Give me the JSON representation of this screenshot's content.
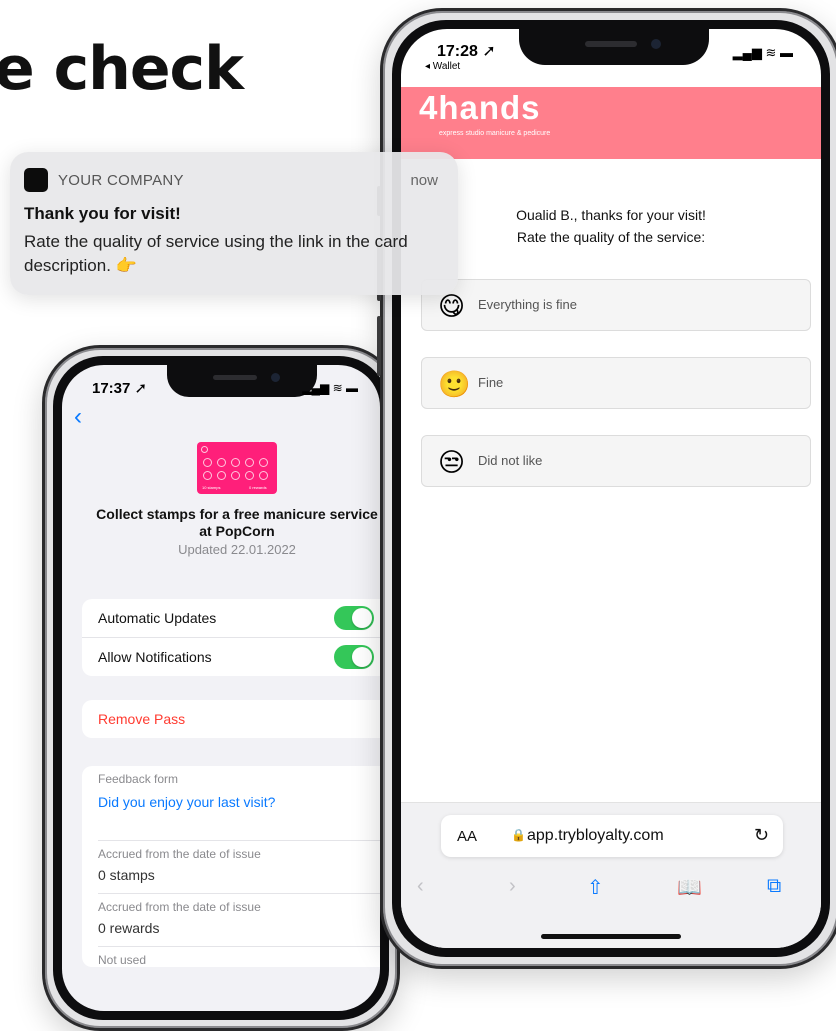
{
  "headline": "e check",
  "notification": {
    "company": "YOUR COMPANY",
    "time": "now",
    "title": "Thank you for visit!",
    "body": "Rate the quality of service using the link in the card description. 👉"
  },
  "left_phone": {
    "time": "17:37",
    "pass": {
      "title": "Collect stamps for a free manicure service at PopCorn",
      "updated": "Updated 22.01.2022",
      "stamps_caption": "10 stamps",
      "rewards_caption": "0 rewards"
    },
    "settings": {
      "automatic_updates": "Automatic Updates",
      "allow_notifications": "Allow Notifications",
      "remove_pass": "Remove Pass"
    },
    "details": {
      "feedback_label": "Feedback form",
      "feedback_link": "Did you enjoy your last visit?",
      "accrued_label_1": "Accrued from the date of issue",
      "accrued_value_1": "0 stamps",
      "accrued_label_2": "Accrued from the date of issue",
      "accrued_value_2": "0 rewards",
      "not_used_label": "Not used"
    }
  },
  "right_phone": {
    "time": "17:28",
    "back_app": "◂ Wallet",
    "brand_logo": "4hands",
    "brand_tagline": "express studio manicure & pedicure",
    "greeting_line1": "Oualid B., thanks for your visit!",
    "greeting_line2": "Rate the quality of the service:",
    "options": [
      {
        "emoji": "😋",
        "label": "Everything is fine"
      },
      {
        "emoji": "🙂",
        "label": "Fine"
      },
      {
        "emoji": "😒",
        "label": "Did not like"
      }
    ],
    "safari": {
      "aa": "AA",
      "url": "app.trybloyalty.com"
    }
  },
  "colors": {
    "brand_pink": "#ff7f8c",
    "pass_pink": "#ff1f7a",
    "ios_blue": "#0a7aff",
    "ios_green": "#34c759",
    "ios_red": "#ff3b30"
  }
}
